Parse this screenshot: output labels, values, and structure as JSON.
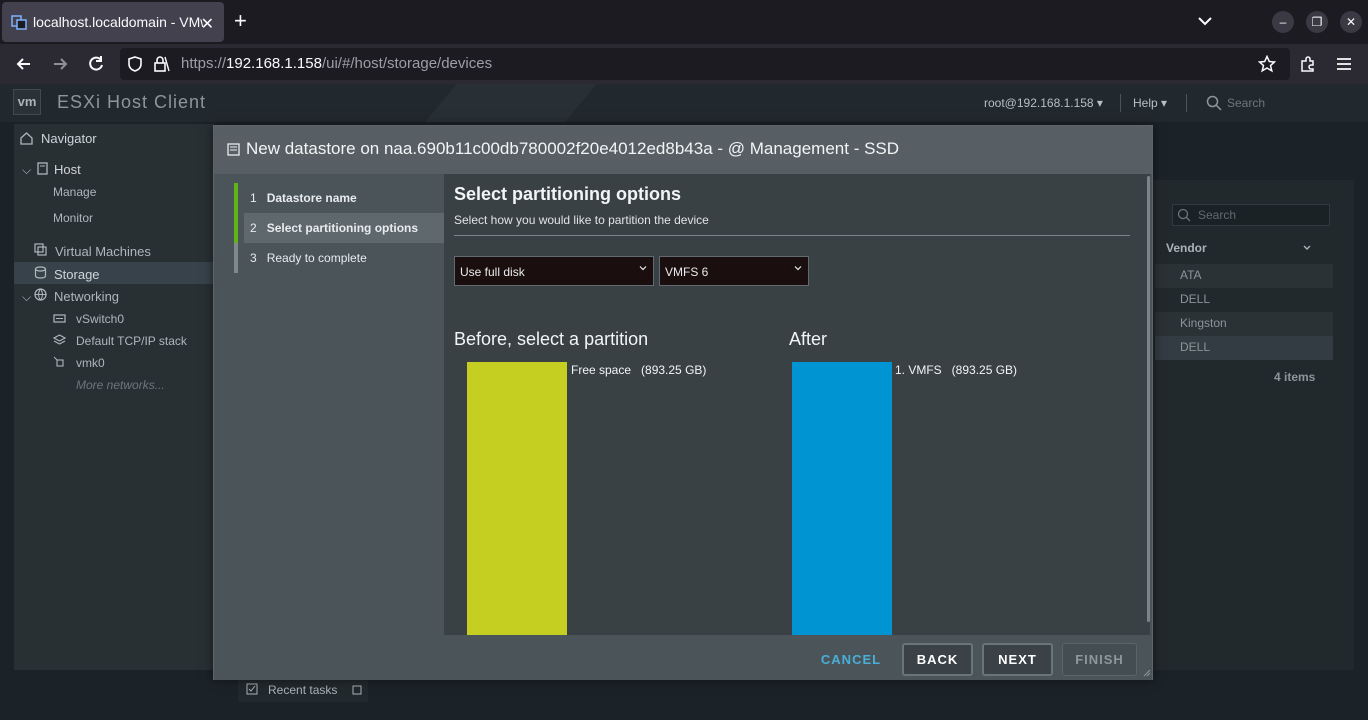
{
  "browser": {
    "tab_title": "localhost.localdomain - VMware ESXi",
    "url_prefix": "https://",
    "url_host": "192.168.1.158",
    "url_path": "/ui/#/host/storage/devices"
  },
  "app": {
    "logo": "vm",
    "title": "ESXi Host Client",
    "user": "root@192.168.1.158 ▾",
    "help": "Help ▾",
    "search_placeholder": "Search"
  },
  "navigator": {
    "title": "Navigator",
    "host": "Host",
    "manage": "Manage",
    "monitor": "Monitor",
    "virtual_machines": "Virtual Machines",
    "storage": "Storage",
    "networking": "Networking",
    "vswitch": "vSwitch0",
    "tcpip": "Default TCP/IP stack",
    "vmk": "vmk0",
    "more": "More networks..."
  },
  "background_panel": {
    "search_placeholder": "Search",
    "vendor_header": "Vendor",
    "vendors": [
      "ATA",
      "DELL",
      "Kingston",
      "DELL"
    ],
    "item_count": "4 items",
    "recent_tasks": "Recent tasks"
  },
  "modal": {
    "title": "New datastore on naa.690b11c00db780002f20e4012ed8b43a - @ Management - SSD",
    "steps": [
      {
        "num": "1",
        "label": "Datastore name"
      },
      {
        "num": "2",
        "label": "Select partitioning options"
      },
      {
        "num": "3",
        "label": "Ready to complete"
      }
    ],
    "heading": "Select partitioning options",
    "subtitle": "Select how you would like to partition the device",
    "partition_select": "Use full disk",
    "vmfs_select": "VMFS 6",
    "before_title": "Before, select a partition",
    "after_title": "After",
    "before_label": "Free space   (893.25 GB)",
    "after_label": "1. VMFS   (893.25 GB)",
    "buttons": {
      "cancel": "CANCEL",
      "back": "BACK",
      "next": "NEXT",
      "finish": "FINISH"
    }
  },
  "colors": {
    "free_space": "#c5cf22",
    "vmfs": "#0094d2",
    "step_done": "#60b515",
    "cancel_link": "#49afd9"
  }
}
